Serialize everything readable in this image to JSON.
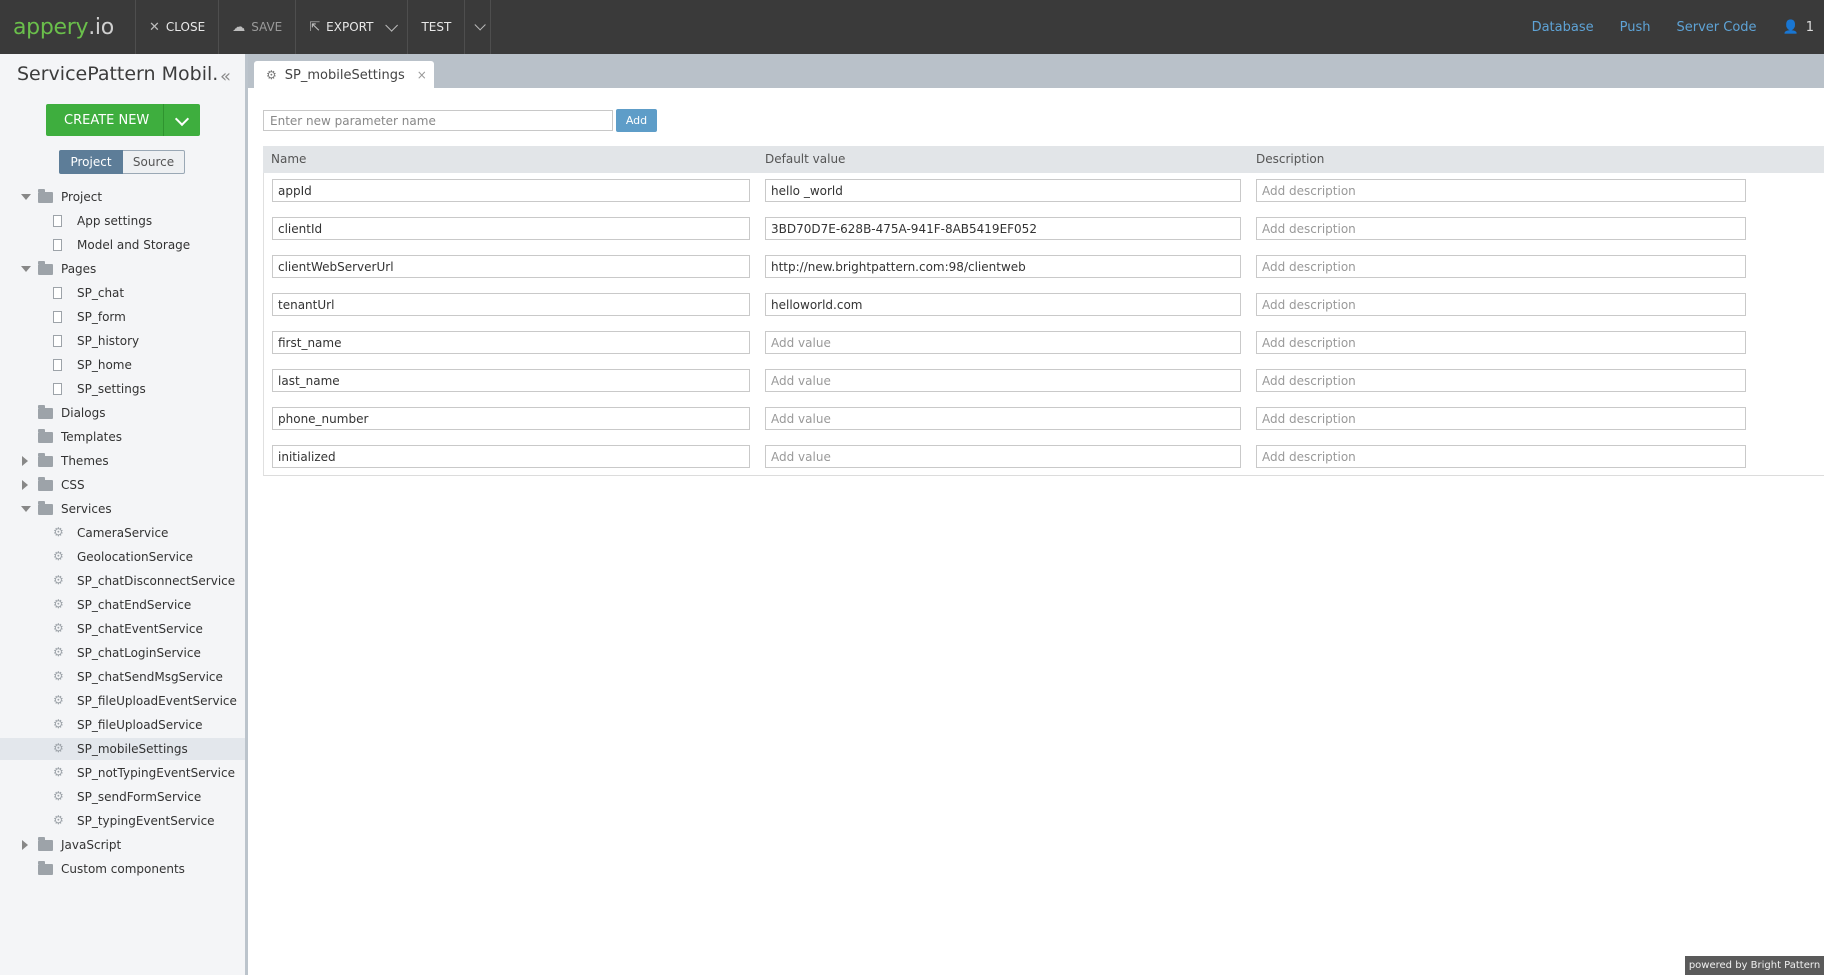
{
  "topbar": {
    "logo_main": "appery",
    "logo_suffix": ".io",
    "close_label": "CLOSE",
    "save_label": "SAVE",
    "export_label": "EXPORT",
    "test_label": "TEST",
    "links": [
      "Database",
      "Push",
      "Server Code"
    ],
    "user_count": "1"
  },
  "sidebar": {
    "project_title": "ServicePattern Mobil...",
    "create_new_label": "CREATE NEW",
    "switch": {
      "project": "Project",
      "source": "Source",
      "active": "Project"
    },
    "tree": [
      {
        "label": "Project",
        "type": "folder",
        "level": 0,
        "expanded": true
      },
      {
        "label": "App settings",
        "type": "settings",
        "level": 1
      },
      {
        "label": "Model and Storage",
        "type": "settings",
        "level": 1
      },
      {
        "label": "Pages",
        "type": "folder",
        "level": 0,
        "expanded": true
      },
      {
        "label": "SP_chat",
        "type": "page",
        "level": 1
      },
      {
        "label": "SP_form",
        "type": "page",
        "level": 1
      },
      {
        "label": "SP_history",
        "type": "page",
        "level": 1
      },
      {
        "label": "SP_home",
        "type": "page",
        "level": 1
      },
      {
        "label": "SP_settings",
        "type": "page",
        "level": 1
      },
      {
        "label": "Dialogs",
        "type": "folder",
        "level": 0,
        "expanded": null
      },
      {
        "label": "Templates",
        "type": "folder",
        "level": 0,
        "expanded": null
      },
      {
        "label": "Themes",
        "type": "folder",
        "level": 0,
        "expanded": false
      },
      {
        "label": "CSS",
        "type": "folder",
        "level": 0,
        "expanded": false
      },
      {
        "label": "Services",
        "type": "folder",
        "level": 0,
        "expanded": true
      },
      {
        "label": "CameraService",
        "type": "service",
        "level": 1
      },
      {
        "label": "GeolocationService",
        "type": "service",
        "level": 1
      },
      {
        "label": "SP_chatDisconnectService",
        "type": "service",
        "level": 1
      },
      {
        "label": "SP_chatEndService",
        "type": "service",
        "level": 1
      },
      {
        "label": "SP_chatEventService",
        "type": "service",
        "level": 1
      },
      {
        "label": "SP_chatLoginService",
        "type": "service",
        "level": 1
      },
      {
        "label": "SP_chatSendMsgService",
        "type": "service",
        "level": 1
      },
      {
        "label": "SP_fileUploadEventService",
        "type": "service",
        "level": 1
      },
      {
        "label": "SP_fileUploadService",
        "type": "service",
        "level": 1
      },
      {
        "label": "SP_mobileSettings",
        "type": "service",
        "level": 1,
        "selected": true
      },
      {
        "label": "SP_notTypingEventService",
        "type": "service",
        "level": 1
      },
      {
        "label": "SP_sendFormService",
        "type": "service",
        "level": 1
      },
      {
        "label": "SP_typingEventService",
        "type": "service",
        "level": 1
      },
      {
        "label": "JavaScript",
        "type": "folder",
        "level": 0,
        "expanded": false
      },
      {
        "label": "Custom components",
        "type": "folder",
        "level": 0,
        "expanded": null
      }
    ]
  },
  "editor": {
    "tab_label": "SP_mobileSettings",
    "new_param_placeholder": "Enter new parameter name",
    "add_label": "Add",
    "columns": {
      "name": "Name",
      "default_value": "Default value",
      "description": "Description"
    },
    "value_placeholder": "Add value",
    "description_placeholder": "Add description",
    "rows": [
      {
        "name": "appId",
        "value": "hello _world"
      },
      {
        "name": "clientId",
        "value": "3BD70D7E-628B-475A-941F-8AB5419EF052"
      },
      {
        "name": "clientWebServerUrl",
        "value": "http://new.brightpattern.com:98/clientweb"
      },
      {
        "name": "tenantUrl",
        "value": "helloworld.com"
      },
      {
        "name": "first_name",
        "value": ""
      },
      {
        "name": "last_name",
        "value": ""
      },
      {
        "name": "phone_number",
        "value": ""
      },
      {
        "name": "initialized",
        "value": ""
      }
    ]
  },
  "footer": {
    "powered": "powered by Bright Pattern"
  },
  "colors": {
    "accent_green": "#3eae3e",
    "link_blue": "#5ea3d6",
    "topbar": "#3a3a3a"
  }
}
